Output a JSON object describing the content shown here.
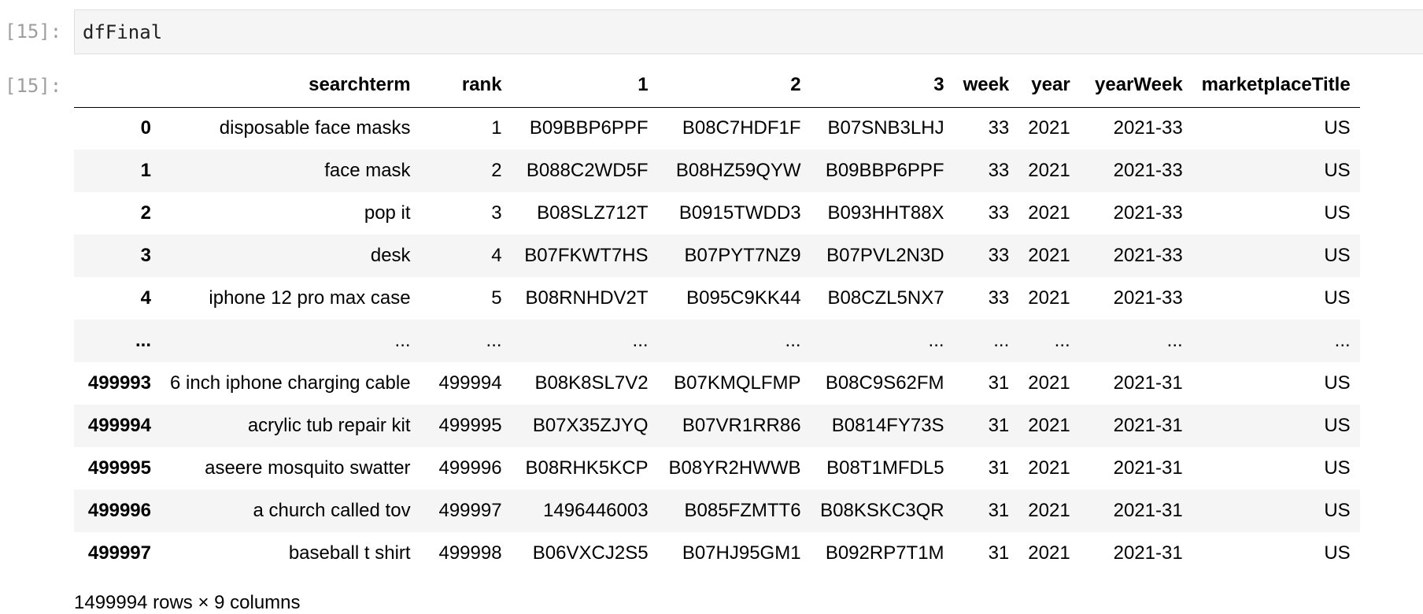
{
  "cell": {
    "input_prompt": "[15]:",
    "output_prompt": "[15]:",
    "code": "dfFinal"
  },
  "table": {
    "columns": [
      "",
      "searchterm",
      "rank",
      "1",
      "2",
      "3",
      "week",
      "year",
      "yearWeek",
      "marketplaceTitle"
    ],
    "rows": [
      [
        "0",
        "disposable face masks",
        "1",
        "B09BBP6PPF",
        "B08C7HDF1F",
        "B07SNB3LHJ",
        "33",
        "2021",
        "2021-33",
        "US"
      ],
      [
        "1",
        "face mask",
        "2",
        "B088C2WD5F",
        "B08HZ59QYW",
        "B09BBP6PPF",
        "33",
        "2021",
        "2021-33",
        "US"
      ],
      [
        "2",
        "pop it",
        "3",
        "B08SLZ712T",
        "B0915TWDD3",
        "B093HHT88X",
        "33",
        "2021",
        "2021-33",
        "US"
      ],
      [
        "3",
        "desk",
        "4",
        "B07FKWT7HS",
        "B07PYT7NZ9",
        "B07PVL2N3D",
        "33",
        "2021",
        "2021-33",
        "US"
      ],
      [
        "4",
        "iphone 12 pro max case",
        "5",
        "B08RNHDV2T",
        "B095C9KK44",
        "B08CZL5NX7",
        "33",
        "2021",
        "2021-33",
        "US"
      ],
      [
        "...",
        "...",
        "...",
        "...",
        "...",
        "...",
        "...",
        "...",
        "...",
        "..."
      ],
      [
        "499993",
        "6 inch iphone charging cable",
        "499994",
        "B08K8SL7V2",
        "B07KMQLFMP",
        "B08C9S62FM",
        "31",
        "2021",
        "2021-31",
        "US"
      ],
      [
        "499994",
        "acrylic tub repair kit",
        "499995",
        "B07X35ZJYQ",
        "B07VR1RR86",
        "B0814FY73S",
        "31",
        "2021",
        "2021-31",
        "US"
      ],
      [
        "499995",
        "aseere mosquito swatter",
        "499996",
        "B08RHK5KCP",
        "B08YR2HWWB",
        "B08T1MFDL5",
        "31",
        "2021",
        "2021-31",
        "US"
      ],
      [
        "499996",
        "a church called tov",
        "499997",
        "1496446003",
        "B085FZMTT6",
        "B08KSKC3QR",
        "31",
        "2021",
        "2021-31",
        "US"
      ],
      [
        "499997",
        "baseball t shirt",
        "499998",
        "B06VXCJ2S5",
        "B07HJ95GM1",
        "B092RP7T1M",
        "31",
        "2021",
        "2021-31",
        "US"
      ]
    ]
  },
  "footer": {
    "summary": "1499994 rows × 9 columns"
  }
}
